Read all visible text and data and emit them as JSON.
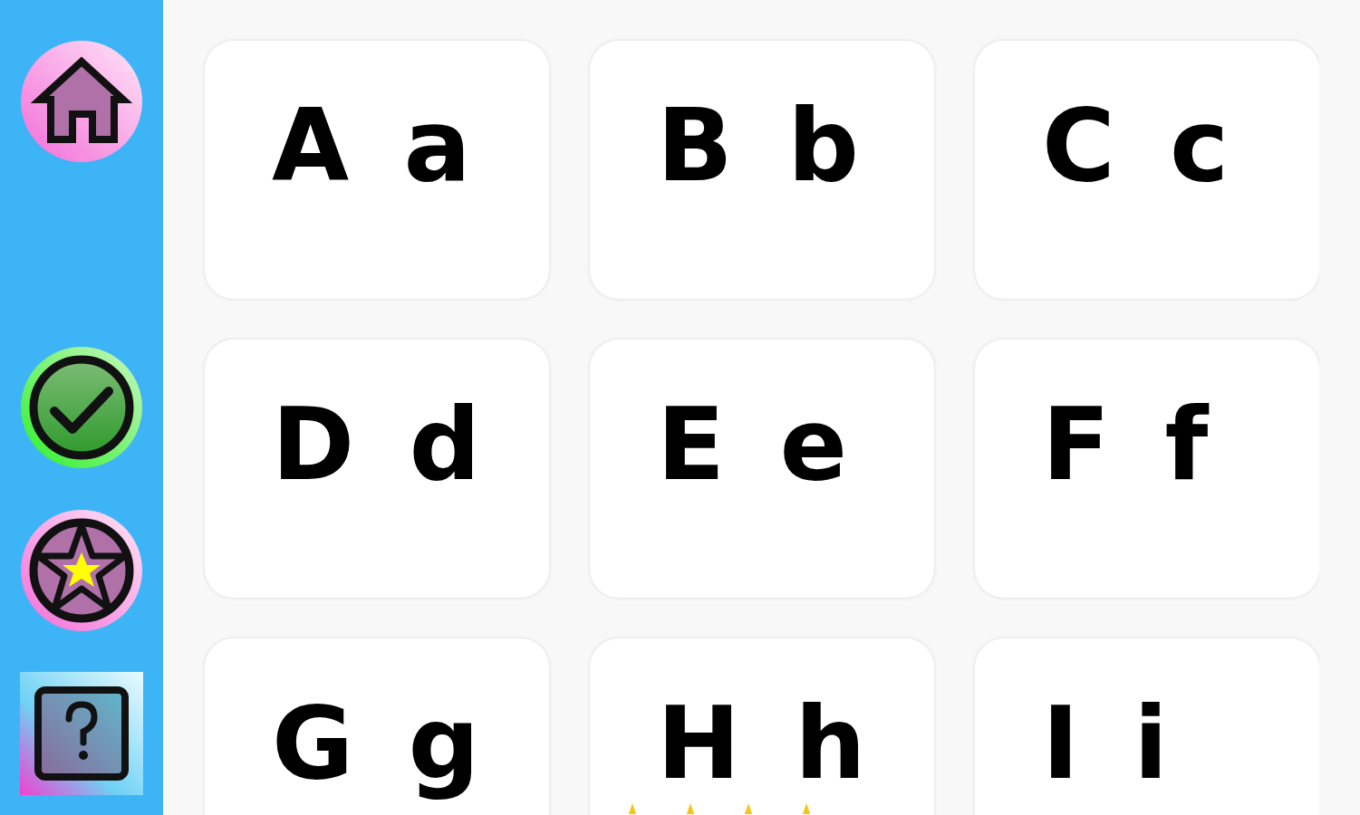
{
  "cards": [
    {
      "letters": "A a"
    },
    {
      "letters": "B b"
    },
    {
      "letters": "C c"
    },
    {
      "letters": "D d"
    },
    {
      "letters": "E e"
    },
    {
      "letters": "F f"
    },
    {
      "letters": "G g"
    },
    {
      "letters": "H h",
      "stars": 4
    },
    {
      "letters": "I i"
    }
  ]
}
